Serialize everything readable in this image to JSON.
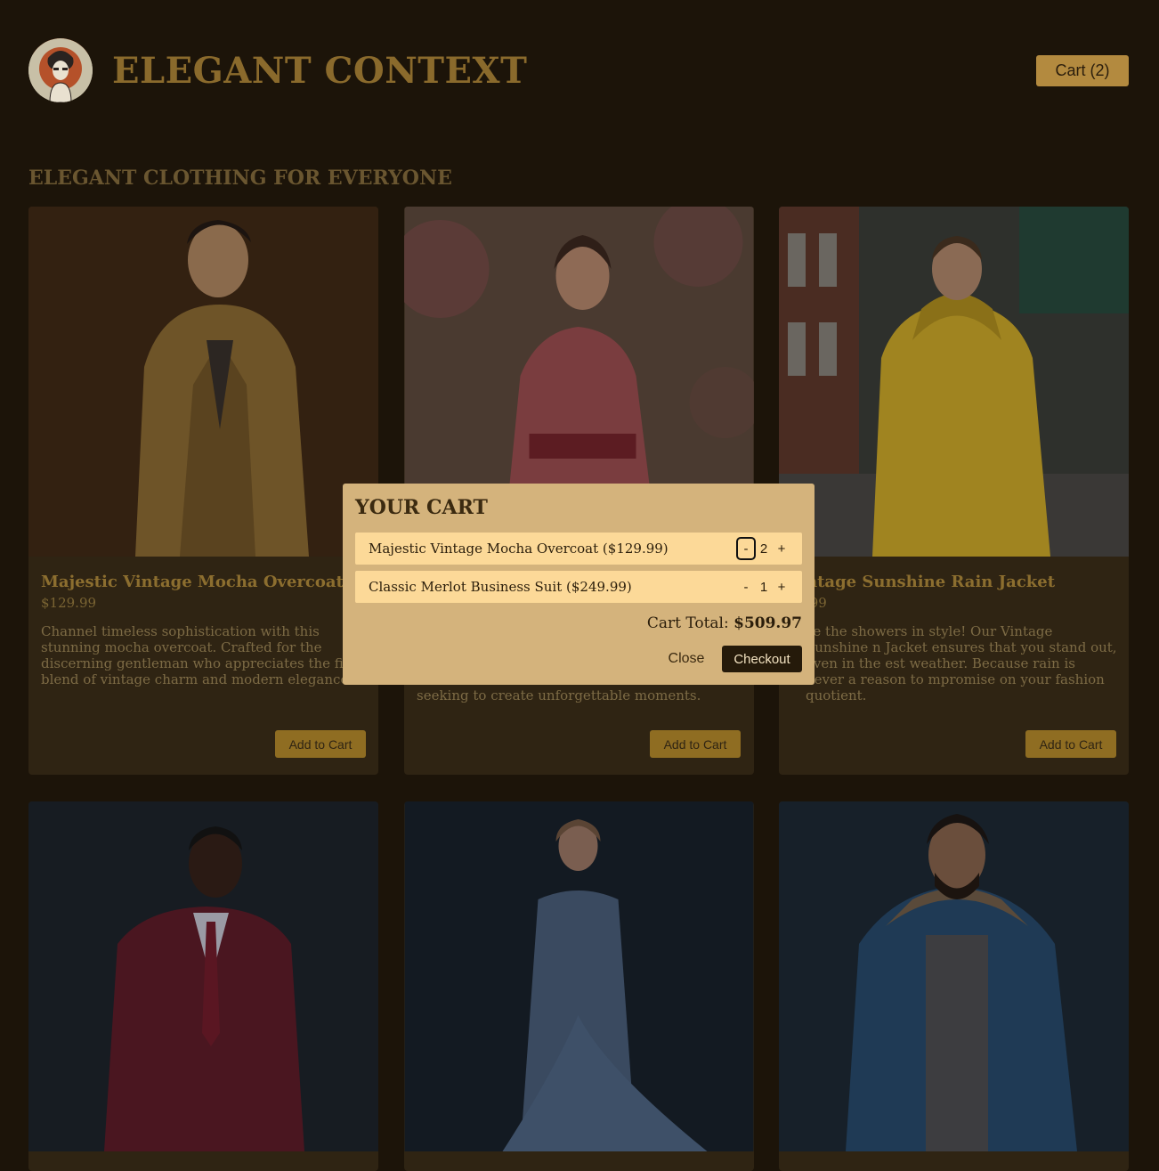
{
  "header": {
    "brand": "ELEGANT CONTEXT",
    "cart_button": "Cart (2)"
  },
  "section_title": "ELEGANT CLOTHING FOR EVERYONE",
  "products": [
    {
      "name": "Majestic Vintage Mocha Overcoat",
      "price": "$129.99",
      "description": "Channel timeless sophistication with this stunning mocha overcoat. Crafted for the discerning gentleman who appreciates the fine blend of vintage charm and modern elegance.",
      "add_label": "Add to Cart"
    },
    {
      "name": "",
      "price": "",
      "description": "seeking to create unforgettable moments.",
      "add_label": "Add to Cart"
    },
    {
      "name": "ntage Sunshine Rain Jacket",
      "price": ".99",
      "description": "ce the showers in style! Our Vintage Sunshine n Jacket ensures that you stand out, even in the est weather. Because rain is never a reason to mpromise on your fashion quotient.",
      "add_label": "Add to Cart"
    }
  ],
  "cart_modal": {
    "title": "YOUR CART",
    "items": [
      {
        "label": "Majestic Vintage Mocha Overcoat ($129.99)",
        "minus": "-",
        "qty": "2",
        "plus": "+"
      },
      {
        "label": "Classic Merlot Business Suit ($249.99)",
        "minus": "-",
        "qty": "1",
        "plus": "+"
      }
    ],
    "total_label": "Cart Total:",
    "total_value": "$509.97",
    "close_label": "Close",
    "checkout_label": "Checkout"
  },
  "colors": {
    "page_bg": "#1c1409",
    "modal_bg": "#d4b37c",
    "row_bg": "#fcd998",
    "checkout_bg": "#251a0a",
    "accent": "#8f6d22"
  },
  "icons": {
    "logo": "woman-portrait-logo-icon"
  }
}
